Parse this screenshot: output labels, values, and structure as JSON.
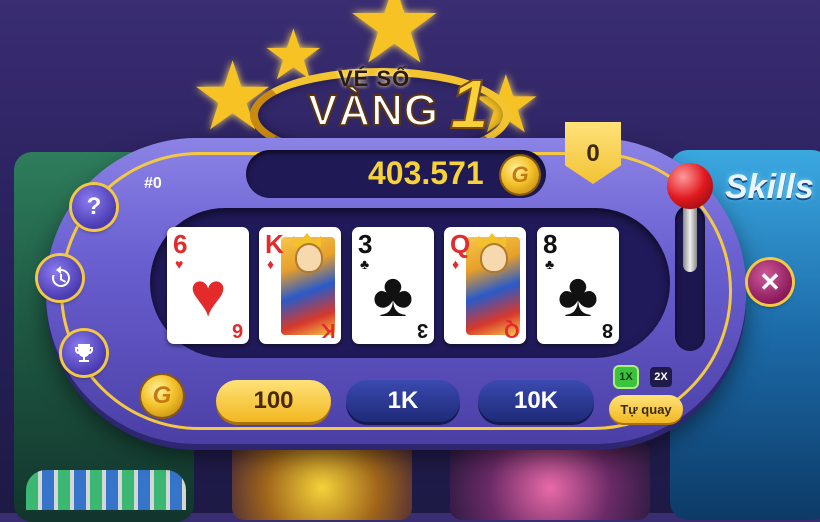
{
  "logo": {
    "top_text": "VÉ SỐ",
    "main_text": "VÀNG",
    "number": "1"
  },
  "balance": {
    "value": "403.571",
    "coin_symbol": "G"
  },
  "badge": {
    "value": "0"
  },
  "round": {
    "id": "#0"
  },
  "side_buttons": {
    "help_symbol": "?",
    "history_icon": "history-icon",
    "trophy_icon": "trophy-icon",
    "close_symbol": "✕"
  },
  "cards": [
    {
      "rank": "6",
      "suit": "♥",
      "color": "#e32b2b",
      "face": false
    },
    {
      "rank": "K",
      "suit": "♦",
      "color": "#e32b2b",
      "face": true
    },
    {
      "rank": "3",
      "suit": "♣",
      "color": "#111111",
      "face": false
    },
    {
      "rank": "Q",
      "suit": "♦",
      "color": "#e32b2b",
      "face": true
    },
    {
      "rank": "8",
      "suit": "♣",
      "color": "#111111",
      "face": false
    }
  ],
  "bets": {
    "coin_symbol": "G",
    "b100": "100",
    "b1k": "1K",
    "b10k": "10K"
  },
  "multipliers": {
    "x1": "1X",
    "x2": "2X"
  },
  "auto_spin": {
    "label": "Tự quay"
  },
  "background": {
    "right_title": "Skills"
  },
  "colors": {
    "accent_gold": "#f3c944",
    "panel_purple": "#6a5fd0"
  }
}
